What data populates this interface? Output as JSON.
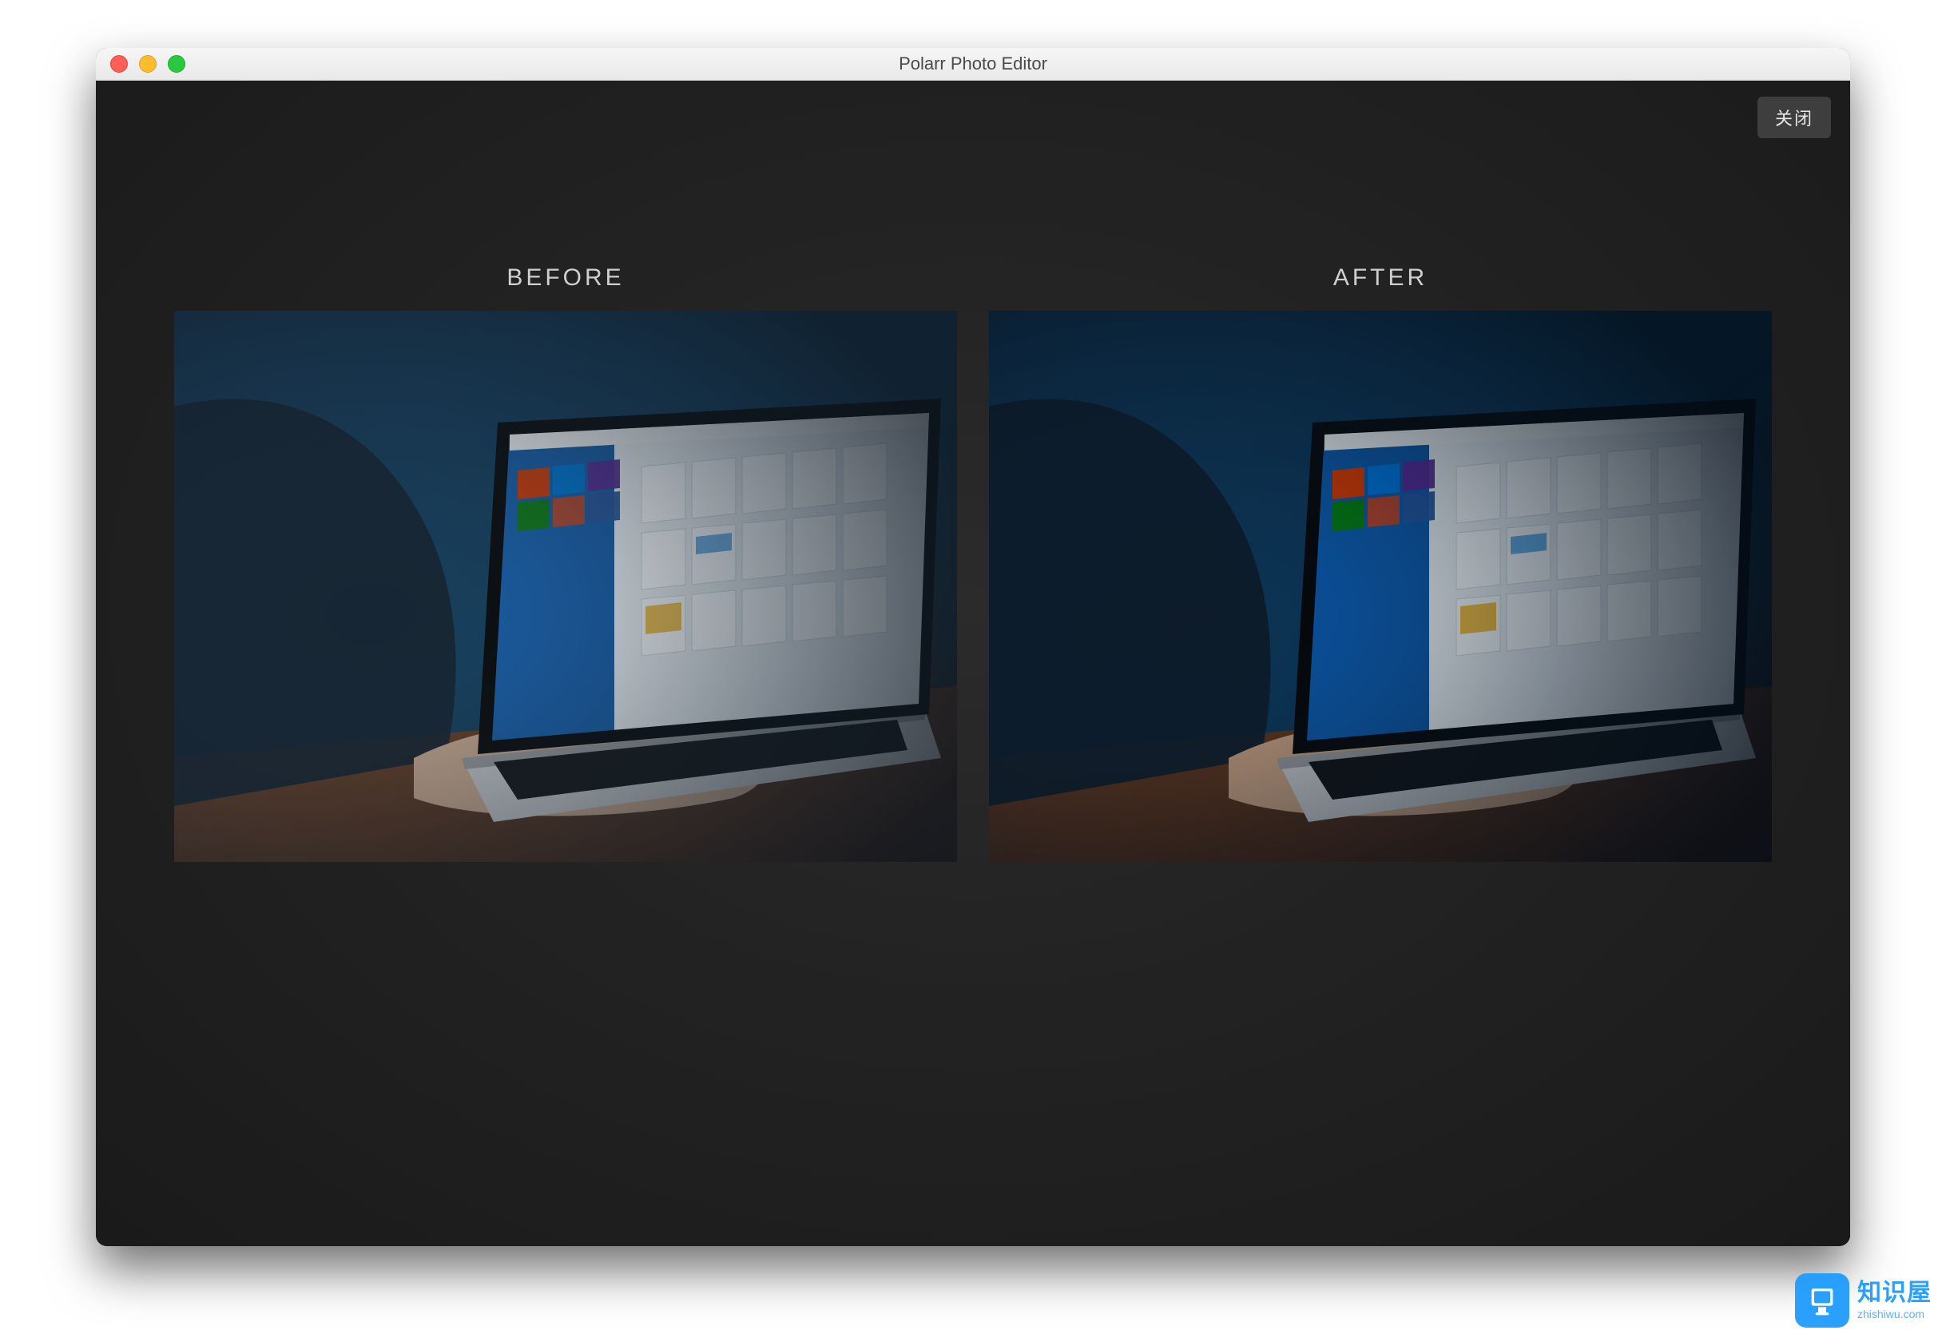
{
  "window": {
    "title": "Polarr Photo Editor"
  },
  "toolbar": {
    "close_label": "关闭"
  },
  "compare": {
    "before_label": "BEFORE",
    "after_label": "AFTER"
  },
  "watermark": {
    "name": "知识屋",
    "domain": "zhishiwu.com"
  }
}
